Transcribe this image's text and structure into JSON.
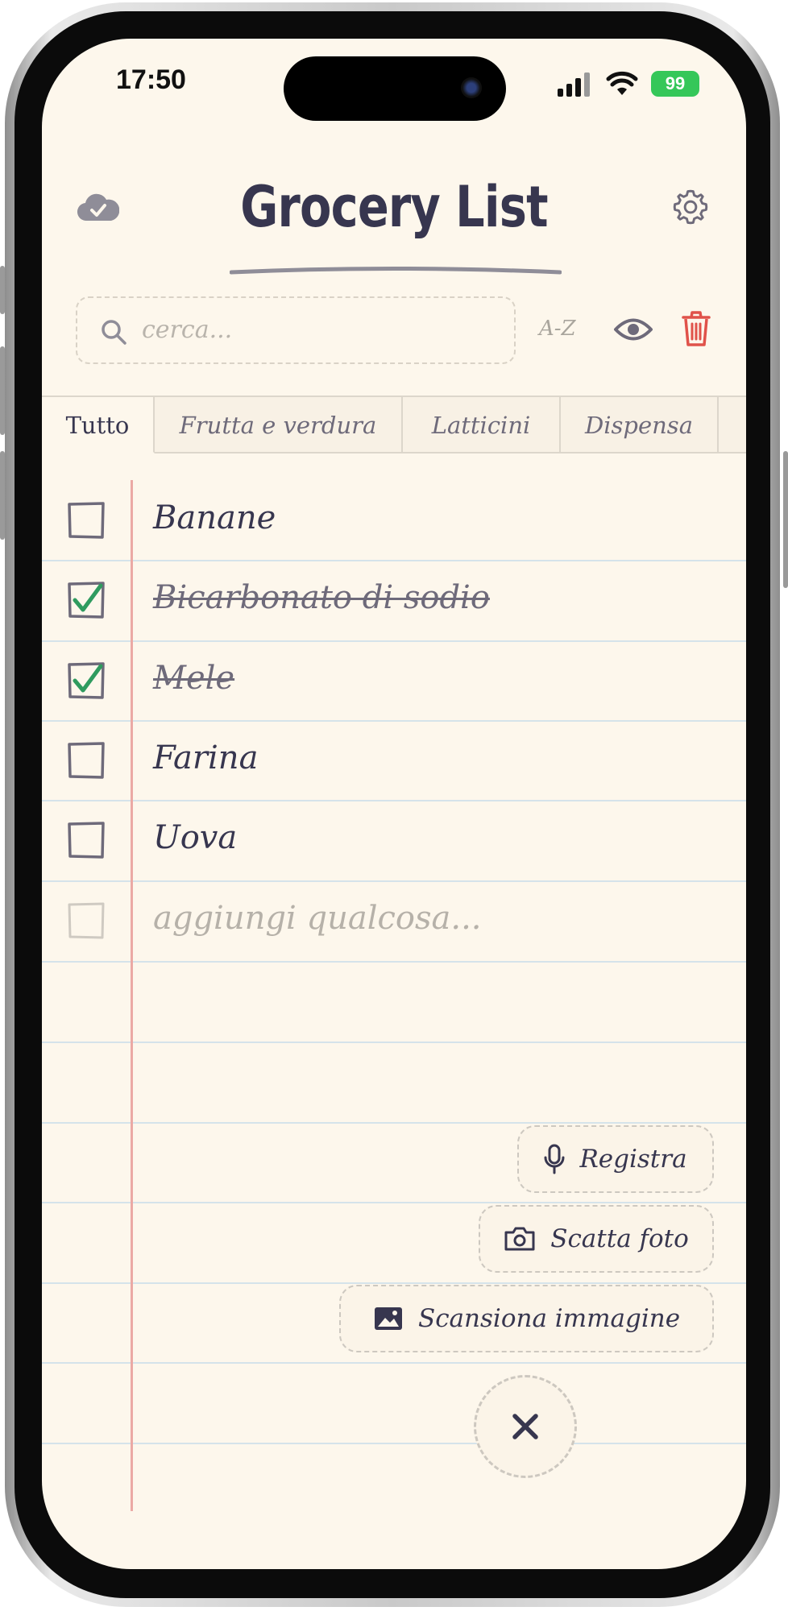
{
  "status_bar": {
    "time": "17:50",
    "battery": "99"
  },
  "header": {
    "title": "Grocery List"
  },
  "search": {
    "placeholder": "cerca..."
  },
  "toolbar": {
    "sort_label": "A-Z"
  },
  "tabs": [
    {
      "label": "Tutto",
      "active": true
    },
    {
      "label": "Frutta e verdura",
      "active": false
    },
    {
      "label": "Latticini",
      "active": false
    },
    {
      "label": "Dispensa",
      "active": false
    }
  ],
  "items": [
    {
      "label": "Banane",
      "checked": false
    },
    {
      "label": "Bicarbonato di sodio",
      "checked": true
    },
    {
      "label": "Mele",
      "checked": true
    },
    {
      "label": "Farina",
      "checked": false
    },
    {
      "label": "Uova",
      "checked": false
    }
  ],
  "add_item": {
    "placeholder": "aggiungi qualcosa..."
  },
  "actions": {
    "record_label": "Registra",
    "photo_label": "Scatta foto",
    "scan_label": "Scansiona immagine"
  },
  "icons": {
    "sync": "cloud-check-icon",
    "settings": "gear-icon",
    "search": "search-icon",
    "visibility": "eye-icon",
    "delete": "trash-icon",
    "record": "microphone-icon",
    "photo": "camera-icon",
    "scan": "image-icon",
    "close": "close-icon"
  },
  "colors": {
    "paper": "#fdf7ec",
    "ink": "#37364f",
    "check_green": "#2f9b5f",
    "delete_red": "#e0524a",
    "margin_red": "#eba9a5",
    "battery_green": "#35c759"
  }
}
